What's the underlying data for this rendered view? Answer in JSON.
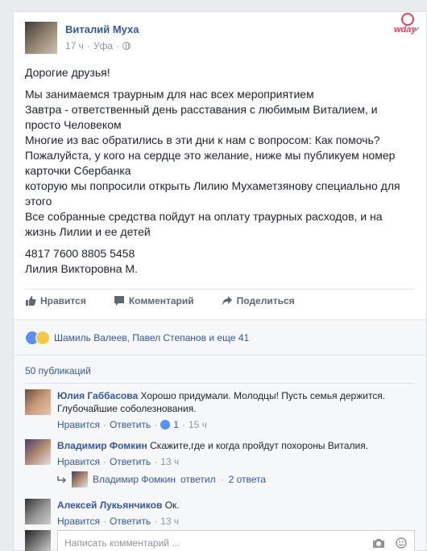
{
  "post": {
    "author": "Виталий Муха",
    "time": "17 ч",
    "place": "Уфа",
    "logo_text": "wday",
    "paragraphs": [
      [
        "Дорогие друзья!"
      ],
      [
        "Мы занимаемся траурным для нас всех мероприятием",
        "Завтра - ответственный день расставания с любимым Виталием, и",
        "просто Человеком",
        "Многие из вас обратились в эти дни к нам с вопросом: Как помочь?",
        "Пожалуйста, у кого на сердце это желание, ниже мы публикуем номер",
        "карточки Сбербанка",
        "которую мы попросили открыть Лилию Мухаметзянову специально для",
        "этого",
        "Все собранные средства пойдут на оплату траурных расходов, и на",
        "жизнь Лилии и ее детей"
      ],
      [
        "4817 7600 8805 5458",
        "Лилия Викторовна М."
      ]
    ]
  },
  "actions": {
    "like": "Нравится",
    "comment": "Комментарий",
    "share": "Поделиться"
  },
  "reactions": {
    "names": "Шамиль Валеев, Павел Степанов и еще 41",
    "icons": [
      "like-icon",
      "sad-icon"
    ]
  },
  "comments_count": "50 публикаций",
  "comments": [
    {
      "name": "Юлия Габбасова",
      "text": "Хорошо придумали. Молодцы! Пусть семья держится.",
      "text2": "Глубочайшие соболезнования.",
      "like": "Нравится",
      "reply": "Ответить",
      "likes": "1",
      "time": "15 ч"
    },
    {
      "name": "Владимир Фомкин",
      "text": "Скажите,где и когда пройдут похороны Виталия.",
      "like": "Нравится",
      "reply": "Ответить",
      "time": "13 ч"
    },
    {
      "name": "Алексей Лукьянчиков",
      "text": "Ок.",
      "like": "Нравится",
      "reply": "Ответить",
      "time": "13 ч"
    }
  ],
  "reply_summary": {
    "name": "Владимир Фомкин",
    "verb": "ответил",
    "count": "2 ответа"
  },
  "input": {
    "placeholder": "Написать комментарий ..."
  },
  "colors": {
    "link": "#365899",
    "muted": "#90949c",
    "brand": "#e1445a"
  }
}
